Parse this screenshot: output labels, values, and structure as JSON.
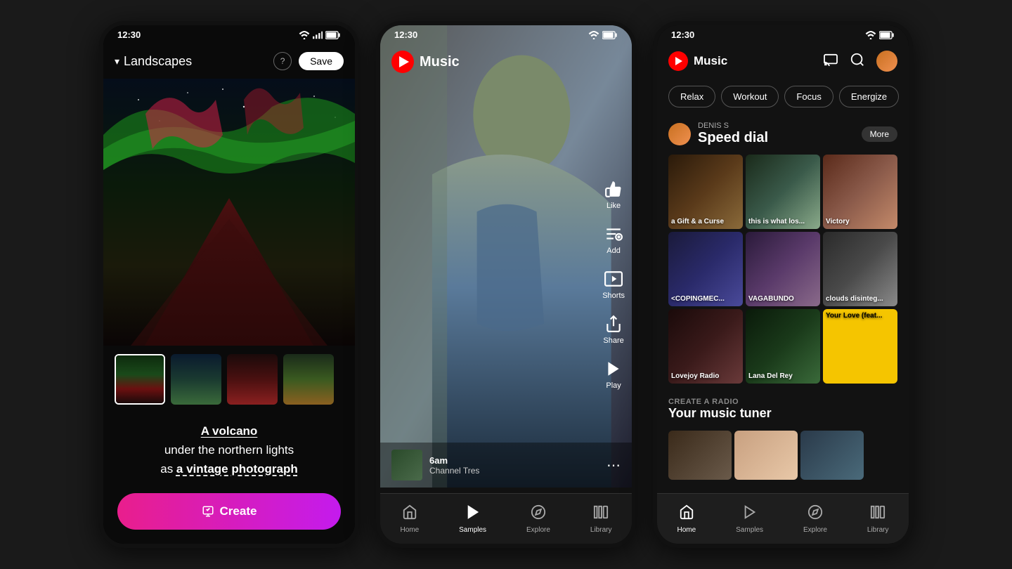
{
  "phones": {
    "phone1": {
      "status_time": "12:30",
      "header_title": "Landscapes",
      "help_tooltip": "?",
      "save_label": "Save",
      "prompt": {
        "line1": "A volcano",
        "line2": "under the northern lights",
        "line3_pre": "as ",
        "line3_bold": "a vintage photograph"
      },
      "create_label": "Create",
      "thumbnails": [
        {
          "id": "thumb-1",
          "active": true
        },
        {
          "id": "thumb-2",
          "active": false
        },
        {
          "id": "thumb-3",
          "active": false
        },
        {
          "id": "thumb-4",
          "active": false
        }
      ]
    },
    "phone2": {
      "status_time": "12:30",
      "app_name": "Music",
      "actions": [
        {
          "label": "Like",
          "icon": "thumbs-up"
        },
        {
          "label": "Add",
          "icon": "add"
        },
        {
          "label": "Shorts",
          "icon": "shorts"
        },
        {
          "label": "Share",
          "icon": "share"
        },
        {
          "label": "Play",
          "icon": "play"
        }
      ],
      "now_playing": {
        "title": "6am",
        "artist": "Channel Tres"
      },
      "nav_items": [
        {
          "label": "Home",
          "icon": "home",
          "active": false
        },
        {
          "label": "Samples",
          "icon": "samples",
          "active": true
        },
        {
          "label": "Explore",
          "icon": "explore",
          "active": false
        },
        {
          "label": "Library",
          "icon": "library",
          "active": false
        }
      ]
    },
    "phone3": {
      "status_time": "12:30",
      "app_name": "Music",
      "mood_chips": [
        {
          "label": "Relax",
          "active": false
        },
        {
          "label": "Workout",
          "active": false
        },
        {
          "label": "Focus",
          "active": false
        },
        {
          "label": "Energize",
          "active": false
        }
      ],
      "section_user": "DENIS S",
      "section_title": "Speed dial",
      "more_label": "More",
      "grid_items": [
        {
          "label": "a Gift & a Curse",
          "color": "gi-1"
        },
        {
          "label": "this is what los...",
          "color": "gi-2"
        },
        {
          "label": "Victory",
          "color": "gi-3"
        },
        {
          "label": "<COPINGMEC...",
          "color": "gi-4"
        },
        {
          "label": "VAGABUNDO",
          "color": "gi-5"
        },
        {
          "label": "clouds disinteg...",
          "color": "gi-6"
        },
        {
          "label": "Lovejoy Radio",
          "color": "gi-7"
        },
        {
          "label": "Lana Del Rey",
          "color": "gi-8"
        },
        {
          "label": "Your Love (feat...",
          "color": "gi-9"
        }
      ],
      "radio_label": "CREATE A RADIO",
      "radio_title": "Your music tuner",
      "nav_items": [
        {
          "label": "Home",
          "icon": "home",
          "active": true
        },
        {
          "label": "Samples",
          "icon": "samples",
          "active": false
        },
        {
          "label": "Explore",
          "icon": "explore",
          "active": false
        },
        {
          "label": "Library",
          "icon": "library",
          "active": false
        }
      ]
    }
  }
}
